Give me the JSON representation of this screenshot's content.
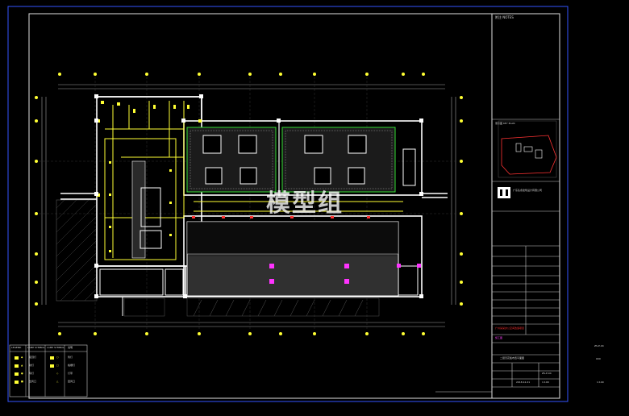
{
  "watermark": "模型组",
  "title_block": {
    "company_name": "广东弘永建筑设计有限公司",
    "logo_letters": "HY",
    "key_plan_label": "索引图 KEY PLAN",
    "notes_label": "附注 NOTES",
    "red_title": "广州某某办公空间改造项目",
    "drawing_title": "二层天花板布置平面图",
    "drawing_no": "ZS-P-04",
    "scale": "1:100",
    "date": "2018.12.21",
    "stage_label": "施工图",
    "margin_code_1": "ZS-P-04",
    "margin_code_2": "000",
    "margin_scale": "1:100"
  },
  "legend": {
    "header": [
      "LEGEND",
      "LAMP SYMBOL",
      "LAMP SYMBOL",
      "说明"
    ],
    "rows": [
      [
        "◆",
        "吸顶灯",
        "○",
        "筒灯"
      ],
      [
        "▲",
        "射灯",
        "□",
        "格栅灯"
      ],
      [
        "●",
        "吊灯",
        "◇",
        "灯带"
      ],
      [
        "■",
        "出风口",
        "△",
        "回风口"
      ]
    ]
  },
  "colors": {
    "wall": "#ffffff",
    "ceiling": "#ffff33",
    "green": "#33dd33",
    "magenta": "#ff33ff",
    "red": "#ff3333",
    "frame": "#d0d0d0",
    "dim": "#3355ff"
  }
}
